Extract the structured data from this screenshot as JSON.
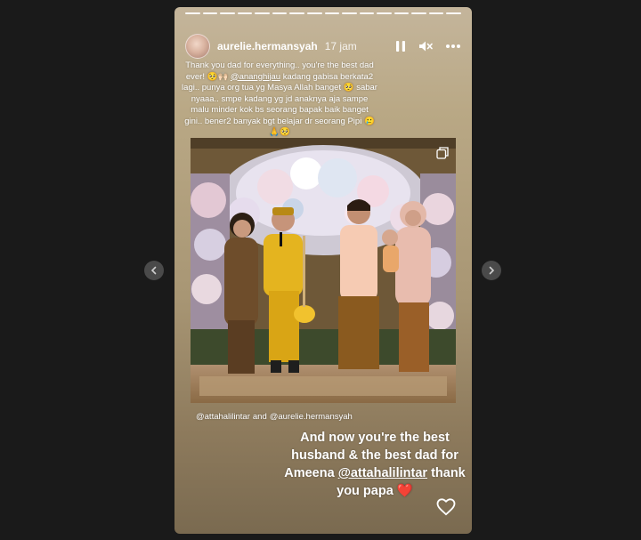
{
  "story": {
    "segments": 16,
    "username": "aurelie.hermansyah",
    "time": "17 jam"
  },
  "caption": {
    "line1": "Thank you dad for everything.. you're the best dad ever! 🥺🙌🏻 ",
    "mention": "@ananghijau",
    "line2": " kadang gabisa berkata2 lagi.. punya org tua yg Masya Allah banget 🥺 sabar nyaaa.. smpe kadang yg jd anaknya aja sampe malu minder kok bs seorang bapak baik banget gini.. bener2 banyak bgt belajar dr seorang Pipi 🥲🙏🥺"
  },
  "tags": {
    "first": "@attahalilintar",
    "joiner": "and",
    "second": "@aurelie.hermansyah"
  },
  "message": {
    "line1": "And now you're the best husband & the best dad for Ameena",
    "mention": "@attahalilintar",
    "line2": " thank you papa",
    "emoji": "❤️"
  },
  "icons": {
    "pause": "pause-icon",
    "mute": "mute-icon",
    "more": "more-icon",
    "like": "heart-icon",
    "prev": "chevron-left-icon",
    "next": "chevron-right-icon"
  },
  "colors": {
    "page_background": "#1a1a1a",
    "story_background": "#b9a885",
    "nav_button": "#4a4a4a",
    "text": "#ffffff"
  }
}
